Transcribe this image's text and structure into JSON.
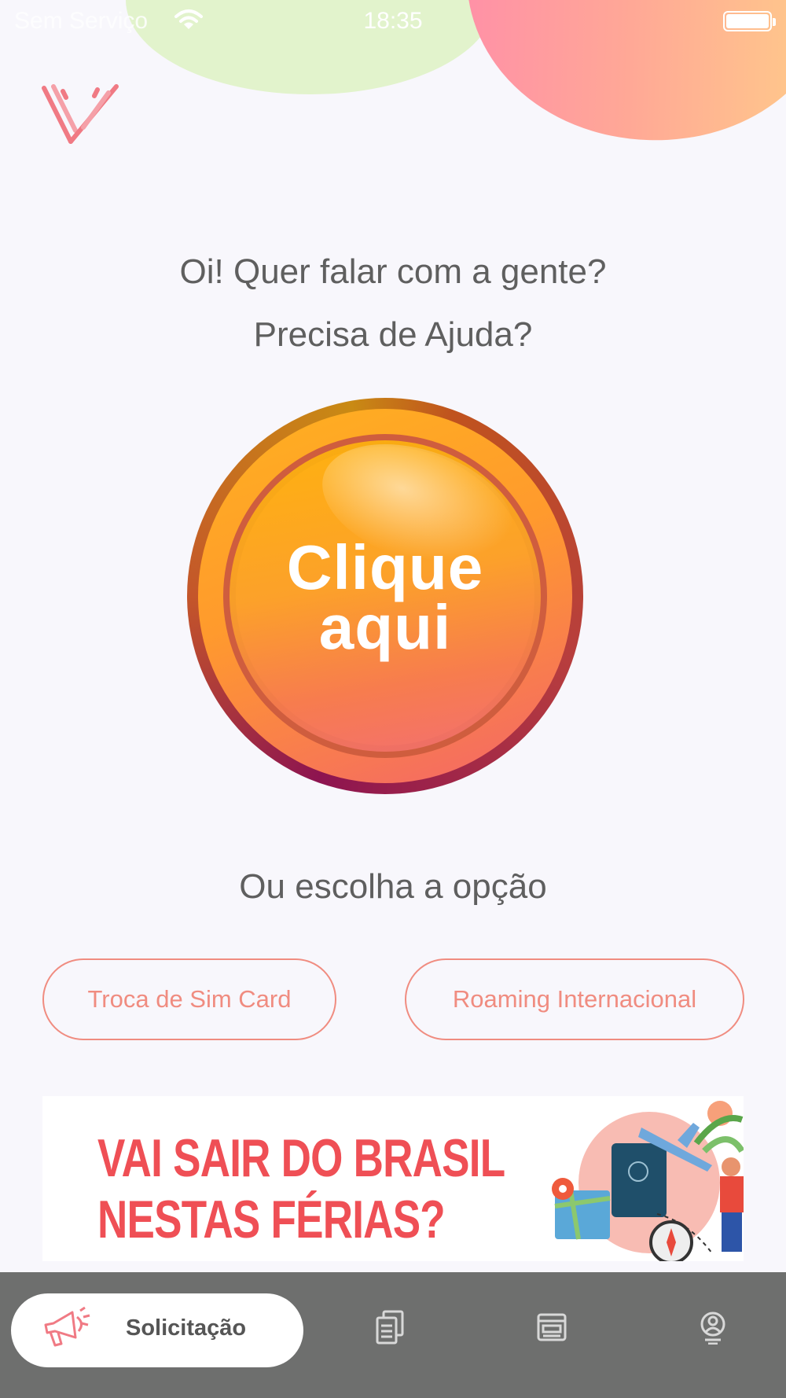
{
  "status_bar": {
    "carrier": "Sem Serviço",
    "time": "18:35"
  },
  "main": {
    "greeting_line1": "Oi! Quer falar com a gente?",
    "greeting_line2": "Precisa de Ajuda?",
    "cta_line1": "Clique",
    "cta_line2": "aqui",
    "choose_label": "Ou escolha a opção",
    "options": [
      "Troca de Sim Card",
      "Roaming Internacional"
    ]
  },
  "banner": {
    "line1": "VAI SAIR DO BRASIL",
    "line2": "NESTAS FÉRIAS?"
  },
  "bottom_nav": {
    "active_label": "Solicitação",
    "items": [
      "megaphone-icon",
      "documents-icon",
      "news-icon",
      "profile-icon"
    ]
  },
  "colors": {
    "accent": "#f08c80",
    "nav_bg": "#6e6f6e",
    "cta_orange": "#ffb20e",
    "banner_red": "#ef4f55"
  }
}
